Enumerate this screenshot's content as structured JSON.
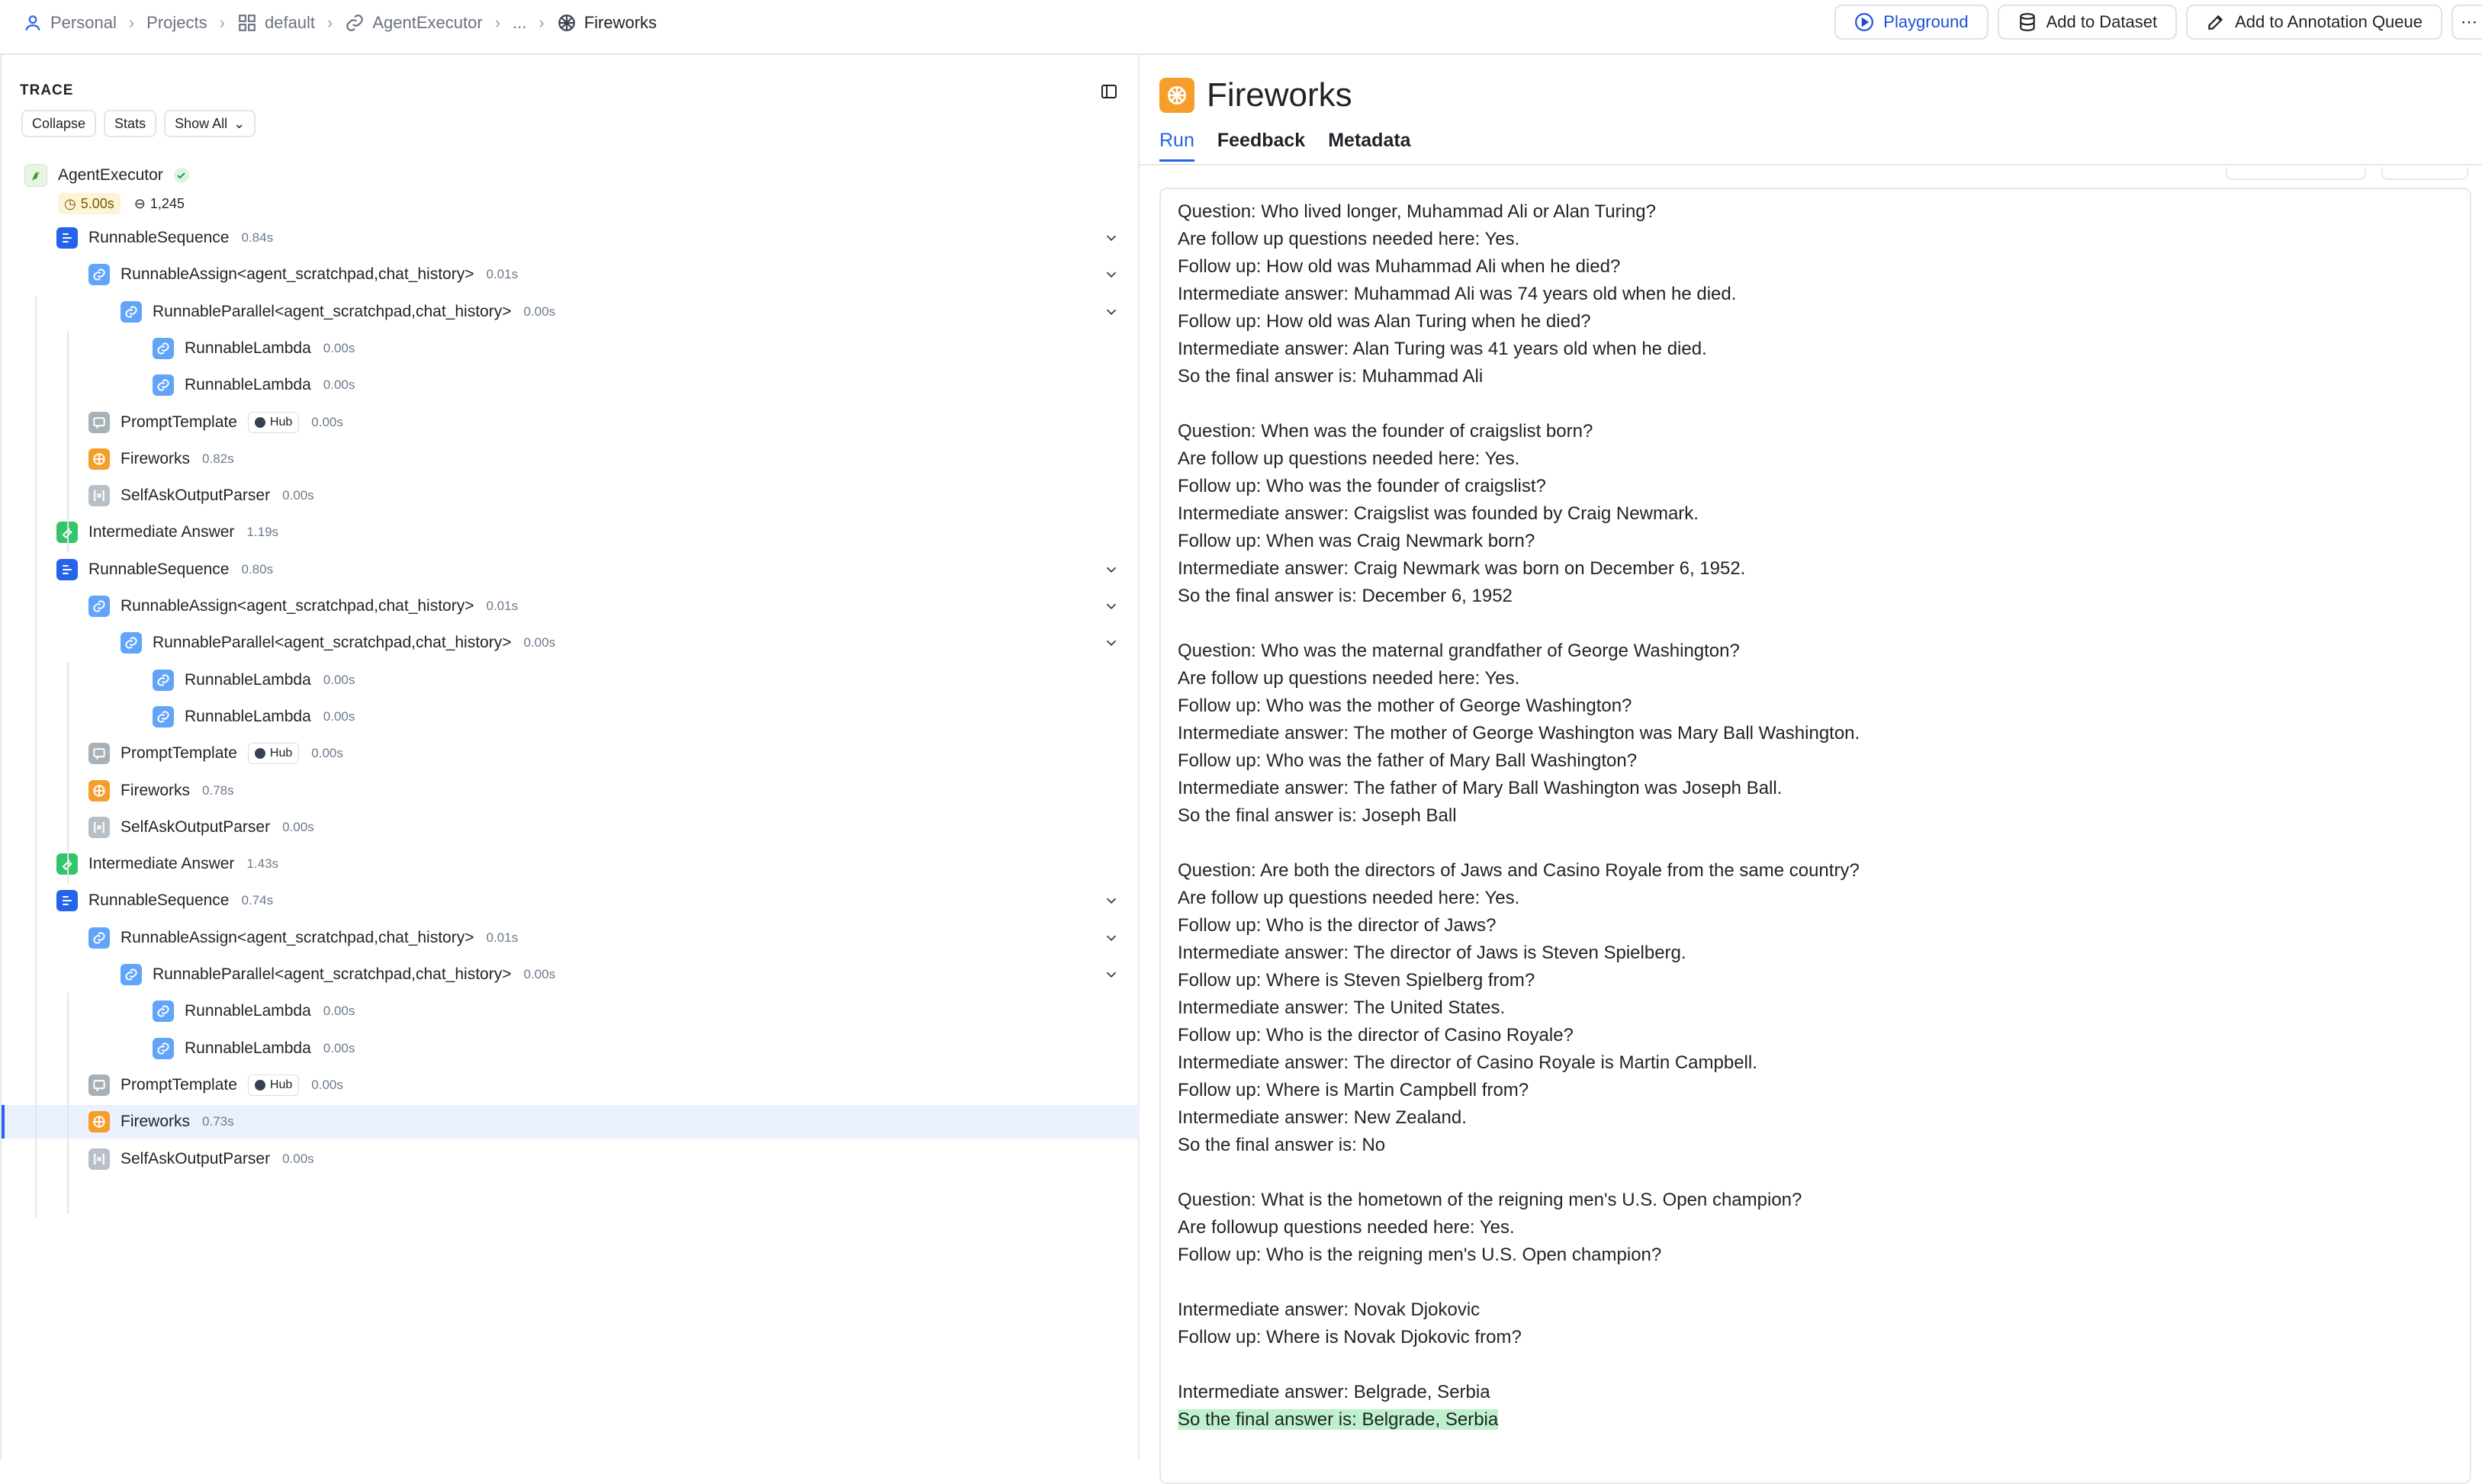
{
  "breadcrumb": {
    "items": [
      {
        "label": "Personal",
        "icon": "user-icon"
      },
      {
        "label": "Projects",
        "icon": ""
      },
      {
        "label": "default",
        "icon": "grid-icon"
      },
      {
        "label": "AgentExecutor",
        "icon": "link-icon"
      },
      {
        "label": "...",
        "icon": ""
      },
      {
        "label": "Fireworks",
        "icon": "fireworks-icon"
      }
    ]
  },
  "actions": {
    "playground": "Playground",
    "add_dataset": "Add to Dataset",
    "add_annotation": "Add to Annotation Queue"
  },
  "trace": {
    "title": "TRACE",
    "collapse": "Collapse",
    "stats": "Stats",
    "show_all": "Show All",
    "root": {
      "name": "AgentExecutor",
      "latency": "5.00s",
      "tokens": "1,245"
    },
    "rows": [
      {
        "name": "RunnableSequence",
        "latency": "0.84s",
        "hub": ""
      },
      {
        "name": "RunnableAssign<agent_scratchpad,chat_history>",
        "latency": "0.01s",
        "hub": ""
      },
      {
        "name": "RunnableParallel<agent_scratchpad,chat_history>",
        "latency": "0.00s",
        "hub": ""
      },
      {
        "name": "RunnableLambda",
        "latency": "0.00s",
        "hub": ""
      },
      {
        "name": "RunnableLambda",
        "latency": "0.00s",
        "hub": ""
      },
      {
        "name": "PromptTemplate",
        "latency": "0.00s",
        "hub": "Hub"
      },
      {
        "name": "Fireworks",
        "latency": "0.82s",
        "hub": ""
      },
      {
        "name": "SelfAskOutputParser",
        "latency": "0.00s",
        "hub": ""
      },
      {
        "name": "Intermediate Answer",
        "latency": "1.19s",
        "hub": ""
      },
      {
        "name": "RunnableSequence",
        "latency": "0.80s",
        "hub": ""
      },
      {
        "name": "RunnableAssign<agent_scratchpad,chat_history>",
        "latency": "0.01s",
        "hub": ""
      },
      {
        "name": "RunnableParallel<agent_scratchpad,chat_history>",
        "latency": "0.00s",
        "hub": ""
      },
      {
        "name": "RunnableLambda",
        "latency": "0.00s",
        "hub": ""
      },
      {
        "name": "RunnableLambda",
        "latency": "0.00s",
        "hub": ""
      },
      {
        "name": "PromptTemplate",
        "latency": "0.00s",
        "hub": "Hub"
      },
      {
        "name": "Fireworks",
        "latency": "0.78s",
        "hub": ""
      },
      {
        "name": "SelfAskOutputParser",
        "latency": "0.00s",
        "hub": ""
      },
      {
        "name": "Intermediate Answer",
        "latency": "1.43s",
        "hub": ""
      },
      {
        "name": "RunnableSequence",
        "latency": "0.74s",
        "hub": ""
      },
      {
        "name": "RunnableAssign<agent_scratchpad,chat_history>",
        "latency": "0.01s",
        "hub": ""
      },
      {
        "name": "RunnableParallel<agent_scratchpad,chat_history>",
        "latency": "0.00s",
        "hub": ""
      },
      {
        "name": "RunnableLambda",
        "latency": "0.00s",
        "hub": ""
      },
      {
        "name": "RunnableLambda",
        "latency": "0.00s",
        "hub": ""
      },
      {
        "name": "PromptTemplate",
        "latency": "0.00s",
        "hub": "Hub"
      },
      {
        "name": "Fireworks",
        "latency": "0.73s",
        "hub": ""
      },
      {
        "name": "SelfAskOutputParser",
        "latency": "0.00s",
        "hub": ""
      }
    ]
  },
  "run": {
    "title": "Fireworks",
    "tabs": [
      "Run",
      "Feedback",
      "Metadata"
    ],
    "lines": [
      "Question: Who lived longer, Muhammad Ali or Alan Turing?",
      "Are follow up questions needed here: Yes.",
      "Follow up: How old was Muhammad Ali when he died?",
      "Intermediate answer: Muhammad Ali was 74 years old when he died.",
      "Follow up: How old was Alan Turing when he died?",
      "Intermediate answer: Alan Turing was 41 years old when he died.",
      "So the final answer is: Muhammad Ali",
      "",
      "Question: When was the founder of craigslist born?",
      "Are follow up questions needed here: Yes.",
      "Follow up: Who was the founder of craigslist?",
      "Intermediate answer: Craigslist was founded by Craig Newmark.",
      "Follow up: When was Craig Newmark born?",
      "Intermediate answer: Craig Newmark was born on December 6, 1952.",
      "So the final answer is: December 6, 1952",
      "",
      "Question: Who was the maternal grandfather of George Washington?",
      "Are follow up questions needed here: Yes.",
      "Follow up: Who was the mother of George Washington?",
      "Intermediate answer: The mother of George Washington was Mary Ball Washington.",
      "Follow up: Who was the father of Mary Ball Washington?",
      "Intermediate answer: The father of Mary Ball Washington was Joseph Ball.",
      "So the final answer is: Joseph Ball",
      "",
      "Question: Are both the directors of Jaws and Casino Royale from the same country?",
      "Are follow up questions needed here: Yes.",
      "Follow up: Who is the director of Jaws?",
      "Intermediate answer: The director of Jaws is Steven Spielberg.",
      "Follow up: Where is Steven Spielberg from?",
      "Intermediate answer: The United States.",
      "Follow up: Who is the director of Casino Royale?",
      "Intermediate answer: The director of Casino Royale is Martin Campbell.",
      "Follow up: Where is Martin Campbell from?",
      "Intermediate answer: New Zealand.",
      "So the final answer is: No",
      "",
      "Question: What is the hometown of the reigning men's U.S. Open champion?",
      "Are followup questions needed here: Yes.",
      "Follow up: Who is the reigning men's U.S. Open champion?",
      "",
      "Intermediate answer: Novak Djokovic",
      "Follow up: Where is Novak Djokovic from?",
      "",
      "Intermediate answer: Belgrade, Serbia"
    ],
    "highlight": "So the final answer is: Belgrade, Serbia"
  }
}
